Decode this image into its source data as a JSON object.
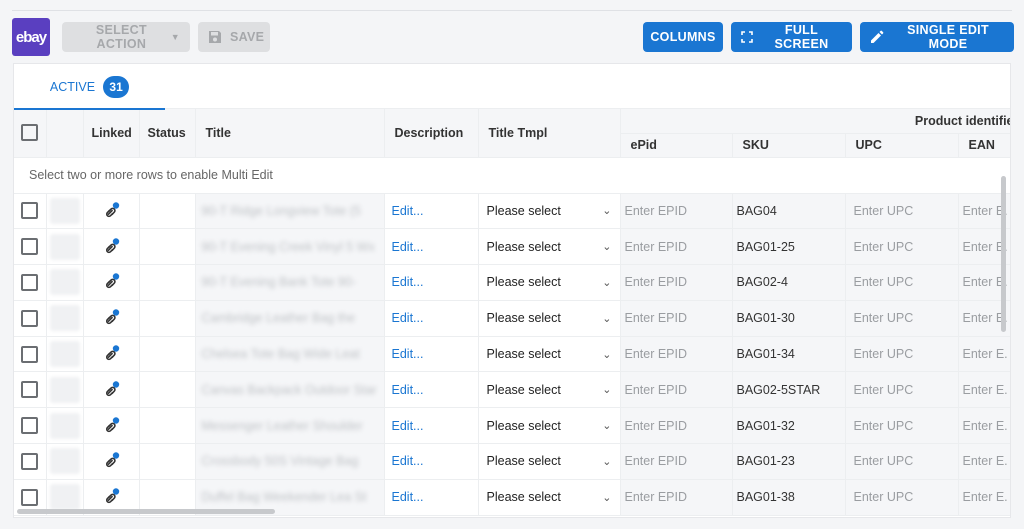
{
  "brand": {
    "logo_text": "ebay",
    "color": "#5a3fc0"
  },
  "toolbar": {
    "select_action_label": "SELECT ACTION",
    "save_label": "SAVE",
    "columns_label": "COLUMNS",
    "full_screen_label": "FULL SCREEN",
    "single_edit_label": "SINGLE EDIT MODE",
    "accent": "#1a76d2"
  },
  "tabs": [
    {
      "label": "ACTIVE",
      "count": "31",
      "active": true
    }
  ],
  "table": {
    "headers": {
      "linked": "Linked",
      "status": "Status",
      "title": "Title",
      "description": "Description",
      "title_tmpl": "Title Tmpl",
      "group": "Product identifie",
      "epid": "ePid",
      "sku": "SKU",
      "upc": "UPC",
      "ean": "EAN"
    },
    "info_message": "Select two or more rows to enable Multi Edit",
    "rows": [
      {
        "title": "90-T Ridge Longview Tote (5",
        "description": "Edit...",
        "title_tmpl": "Please select",
        "epid": "Enter EPID",
        "sku": "BAG04",
        "upc": "Enter UPC",
        "ean": "Enter E."
      },
      {
        "title": "90-T Evening Creek Vinyl 5 Wx",
        "description": "Edit...",
        "title_tmpl": "Please select",
        "epid": "Enter EPID",
        "sku": "BAG01-25",
        "upc": "Enter UPC",
        "ean": "Enter E."
      },
      {
        "title": "90-T Evening Bank Tote 90-",
        "description": "Edit...",
        "title_tmpl": "Please select",
        "epid": "Enter EPID",
        "sku": "BAG02-4",
        "upc": "Enter UPC",
        "ean": "Enter E."
      },
      {
        "title": "Cambridge Leather Bag the",
        "description": "Edit...",
        "title_tmpl": "Please select",
        "epid": "Enter EPID",
        "sku": "BAG01-30",
        "upc": "Enter UPC",
        "ean": "Enter E."
      },
      {
        "title": "Chelsea Tote Bag Wide Leat",
        "description": "Edit...",
        "title_tmpl": "Please select",
        "epid": "Enter EPID",
        "sku": "BAG01-34",
        "upc": "Enter UPC",
        "ean": "Enter E."
      },
      {
        "title": "Canvas Backpack Outdoor Star",
        "description": "Edit...",
        "title_tmpl": "Please select",
        "epid": "Enter EPID",
        "sku": "BAG02-5STAR",
        "upc": "Enter UPC",
        "ean": "Enter E."
      },
      {
        "title": "Messenger Leather Shoulder",
        "description": "Edit...",
        "title_tmpl": "Please select",
        "epid": "Enter EPID",
        "sku": "BAG01-32",
        "upc": "Enter UPC",
        "ean": "Enter E."
      },
      {
        "title": "Crossbody 50S Vintage Bag",
        "description": "Edit...",
        "title_tmpl": "Please select",
        "epid": "Enter EPID",
        "sku": "BAG01-23",
        "upc": "Enter UPC",
        "ean": "Enter E."
      },
      {
        "title": "Duffel Bag Weekender Lea St",
        "description": "Edit...",
        "title_tmpl": "Please select",
        "epid": "Enter EPID",
        "sku": "BAG01-38",
        "upc": "Enter UPC",
        "ean": "Enter E."
      }
    ]
  }
}
